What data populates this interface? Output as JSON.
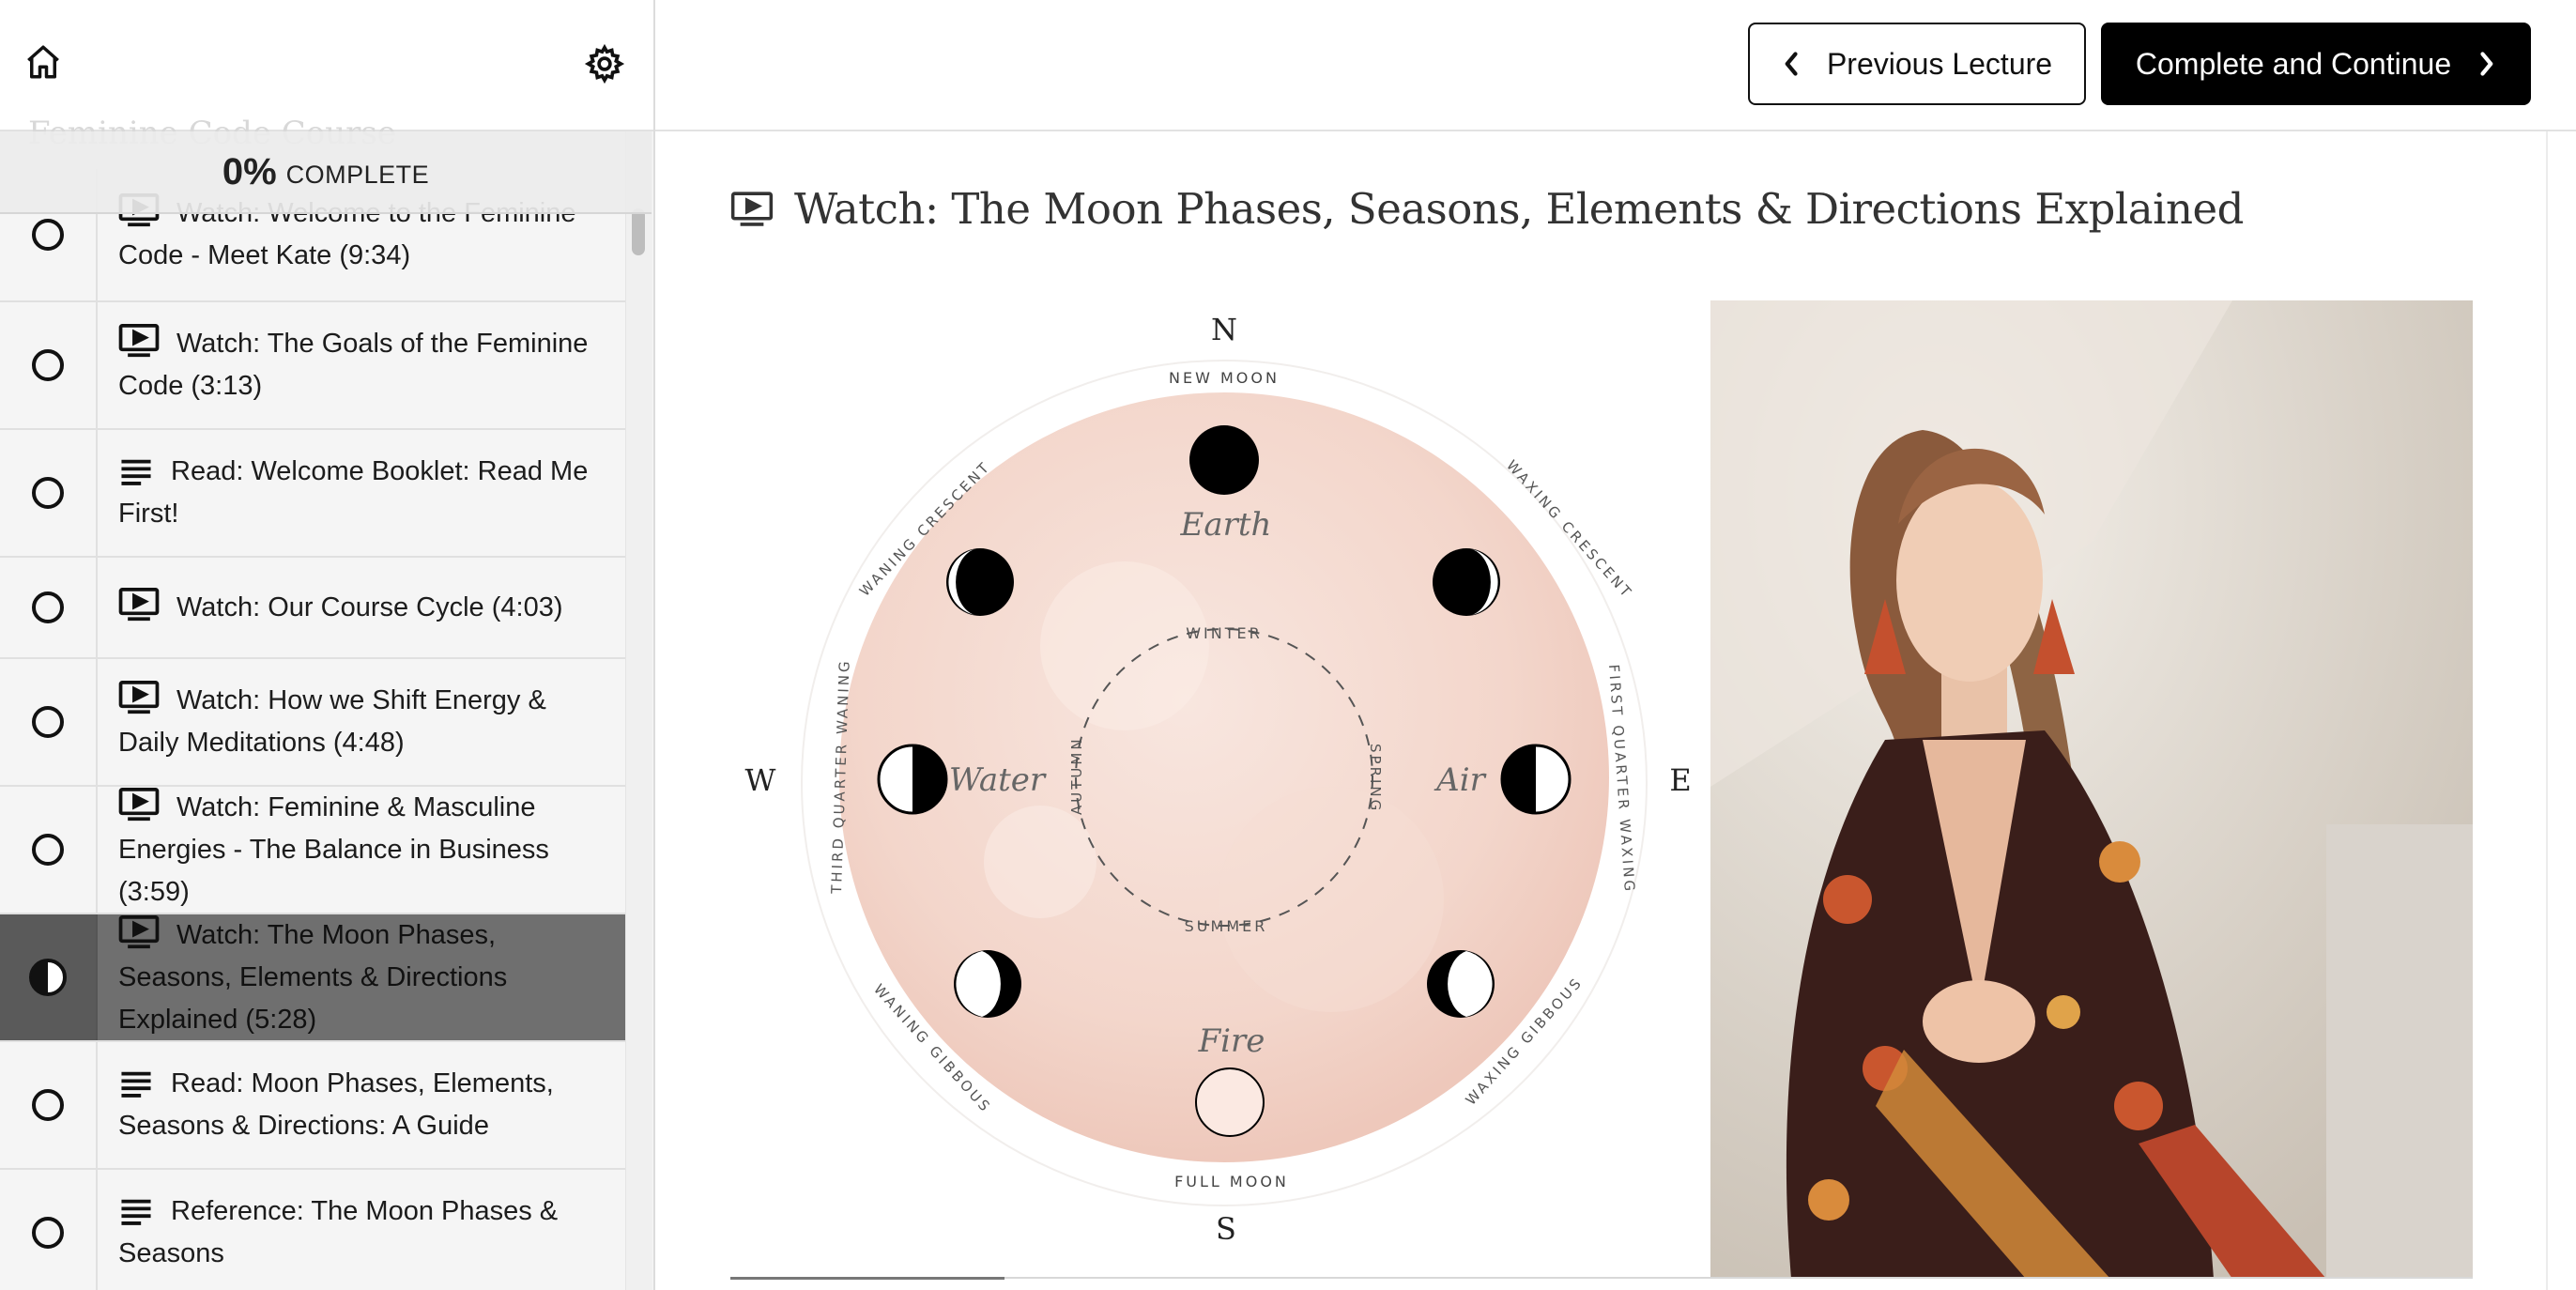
{
  "sidebar": {
    "course_title": "Feminine Code Course",
    "progress": {
      "percent_label": "0%",
      "complete_label": "COMPLETE",
      "value": 0
    },
    "lectures": [
      {
        "type": "video",
        "label": "Watch: Welcome to the Feminine Code - Meet Kate (9:34)",
        "status": "incomplete"
      },
      {
        "type": "video",
        "label": "Watch: The Goals of the Feminine Code (3:13)",
        "status": "incomplete"
      },
      {
        "type": "text",
        "label": "Read: Welcome Booklet: Read Me First!",
        "status": "incomplete"
      },
      {
        "type": "video",
        "label": "Watch: Our Course Cycle (4:03)",
        "status": "incomplete"
      },
      {
        "type": "video",
        "label": "Watch: How we Shift Energy & Daily Meditations (4:48)",
        "status": "incomplete"
      },
      {
        "type": "video",
        "label": "Watch: Feminine & Masculine Energies - The Balance in Business (3:59)",
        "status": "incomplete"
      },
      {
        "type": "video",
        "label": "Watch: The Moon Phases, Seasons, Elements & Directions Explained (5:28)",
        "status": "in-progress"
      },
      {
        "type": "text",
        "label": "Read: Moon Phases, Elements, Seasons & Directions: A Guide",
        "status": "incomplete"
      },
      {
        "type": "text",
        "label": "Reference: The Moon Phases & Seasons",
        "status": "incomplete"
      }
    ]
  },
  "topbar": {
    "prev_label": "Previous Lecture",
    "next_label": "Complete and Continue"
  },
  "lecture": {
    "title": "Watch: The Moon Phases, Seasons, Elements & Directions Explained"
  },
  "diagram": {
    "directions": {
      "n": "N",
      "s": "S",
      "e": "E",
      "w": "W"
    },
    "phases": {
      "new": "NEW MOON",
      "full": "FULL MOON",
      "waxing_crescent": "WAXING CRESCENT",
      "first_quarter": "FIRST QUARTER WAXING",
      "waxing_gibbous": "WAXING GIBBOUS",
      "waning_gibbous": "WANING GIBBOUS",
      "third_quarter": "THIRD QUARTER WANING",
      "waning_crescent": "WANING CRESCENT"
    },
    "elements": {
      "earth": "Earth",
      "air": "Air",
      "fire": "Fire",
      "water": "Water"
    },
    "seasons": {
      "winter": "WINTER",
      "spring": "SPRING",
      "summer": "SUMMER",
      "autumn": "AUTUMN"
    }
  },
  "colors": {
    "accent": "#000000",
    "active_row": "#6f6f6f",
    "moon_pink": "#f4d9d0"
  },
  "icons": {
    "home": "home-icon",
    "settings": "gear-icon",
    "video": "video-icon",
    "text": "text-lines-icon",
    "prev": "chevron-left-icon",
    "next": "chevron-right-icon"
  }
}
